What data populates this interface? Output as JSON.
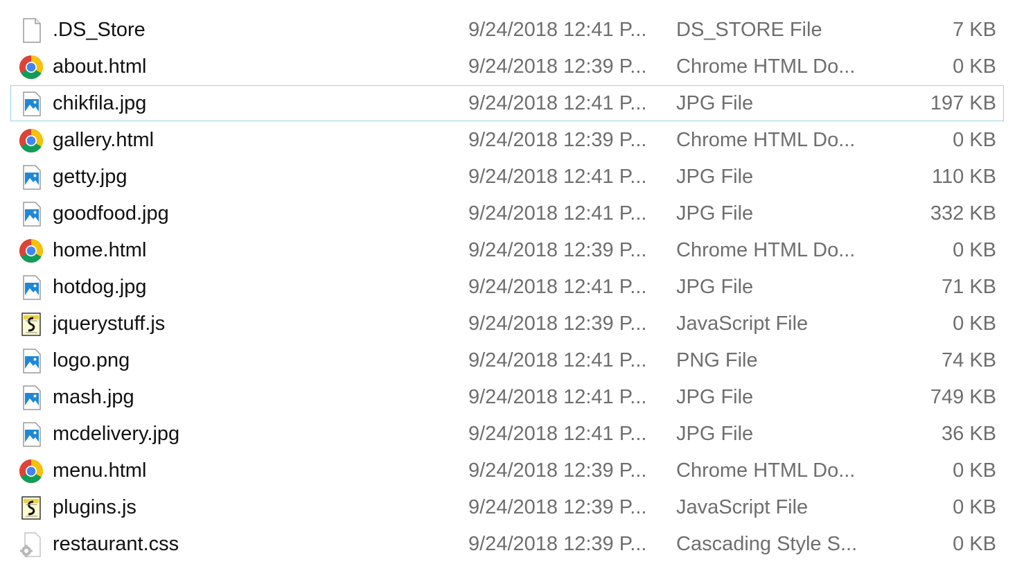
{
  "files": [
    {
      "name": ".DS_Store",
      "date": "9/24/2018 12:41 P...",
      "type": "DS_STORE File",
      "size": "7 KB",
      "icon": "generic-file-icon"
    },
    {
      "name": "about.html",
      "date": "9/24/2018 12:39 P...",
      "type": "Chrome HTML Do...",
      "size": "0 KB",
      "icon": "chrome-icon"
    },
    {
      "name": "chikfila.jpg",
      "date": "9/24/2018 12:41 P...",
      "type": "JPG File",
      "size": "197 KB",
      "icon": "image-file-icon",
      "selected": true
    },
    {
      "name": "gallery.html",
      "date": "9/24/2018 12:39 P...",
      "type": "Chrome HTML Do...",
      "size": "0 KB",
      "icon": "chrome-icon"
    },
    {
      "name": "getty.jpg",
      "date": "9/24/2018 12:41 P...",
      "type": "JPG File",
      "size": "110 KB",
      "icon": "image-file-icon"
    },
    {
      "name": "goodfood.jpg",
      "date": "9/24/2018 12:41 P...",
      "type": "JPG File",
      "size": "332 KB",
      "icon": "image-file-icon"
    },
    {
      "name": "home.html",
      "date": "9/24/2018 12:39 P...",
      "type": "Chrome HTML Do...",
      "size": "0 KB",
      "icon": "chrome-icon"
    },
    {
      "name": "hotdog.jpg",
      "date": "9/24/2018 12:41 P...",
      "type": "JPG File",
      "size": "71 KB",
      "icon": "image-file-icon"
    },
    {
      "name": "jquerystuff.js",
      "date": "9/24/2018 12:39 P...",
      "type": "JavaScript File",
      "size": "0 KB",
      "icon": "javascript-file-icon"
    },
    {
      "name": "logo.png",
      "date": "9/24/2018 12:41 P...",
      "type": "PNG File",
      "size": "74 KB",
      "icon": "image-file-icon"
    },
    {
      "name": "mash.jpg",
      "date": "9/24/2018 12:41 P...",
      "type": "JPG File",
      "size": "749 KB",
      "icon": "image-file-icon"
    },
    {
      "name": "mcdelivery.jpg",
      "date": "9/24/2018 12:41 P...",
      "type": "JPG File",
      "size": "36 KB",
      "icon": "image-file-icon"
    },
    {
      "name": "menu.html",
      "date": "9/24/2018 12:39 P...",
      "type": "Chrome HTML Do...",
      "size": "0 KB",
      "icon": "chrome-icon"
    },
    {
      "name": "plugins.js",
      "date": "9/24/2018 12:39 P...",
      "type": "JavaScript File",
      "size": "0 KB",
      "icon": "javascript-file-icon"
    },
    {
      "name": "restaurant.css",
      "date": "9/24/2018 12:39 P...",
      "type": "Cascading Style S...",
      "size": "0 KB",
      "icon": "css-file-icon"
    }
  ],
  "colors": {
    "selection_border": "#99d1e6",
    "name_text": "#111111",
    "detail_text": "#6e6e6e",
    "image_icon_blue": "#1e88d6"
  }
}
